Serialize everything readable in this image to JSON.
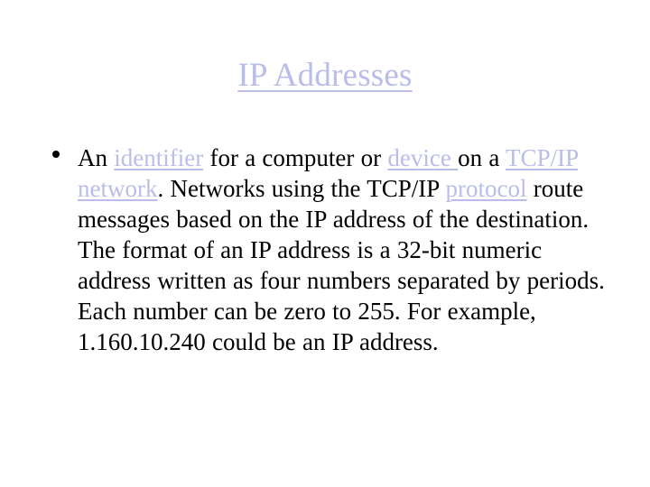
{
  "slide": {
    "title": "IP Addresses",
    "title_color": "#b9bde9",
    "background_color": "#ffffff",
    "body_text_color": "#000000",
    "link_color": "#b9bde9",
    "bullet_glyph": "•",
    "bullets": [
      {
        "segments": [
          {
            "text": "An ",
            "link": false
          },
          {
            "text": "identifier",
            "link": true
          },
          {
            "text": " for a computer or ",
            "link": false
          },
          {
            "text": "device ",
            "link": true
          },
          {
            "text": "on a ",
            "link": false
          },
          {
            "text": "TCP/IP",
            "link": true
          },
          {
            "text": " ",
            "link": false
          },
          {
            "text": "network",
            "link": true
          },
          {
            "text": ". Networks using the TCP/IP ",
            "link": false
          },
          {
            "text": "protocol",
            "link": true
          },
          {
            "text": " route messages based on the IP address of the destination. The format of an IP address is a 32-bit numeric address written as four numbers separated by periods. Each number can be zero to 255. For example, 1.160.10.240 could be an IP address.",
            "link": false
          }
        ],
        "plain_text": "An identifier for a computer or device on a TCP/IP network. Networks using the TCP/IP protocol route messages based on the IP address of the destination. The format of an IP address is a 32-bit numeric address written as four numbers separated by periods. Each number can be zero to 255. For example, 1.160.10.240 could be an IP address."
      }
    ]
  }
}
